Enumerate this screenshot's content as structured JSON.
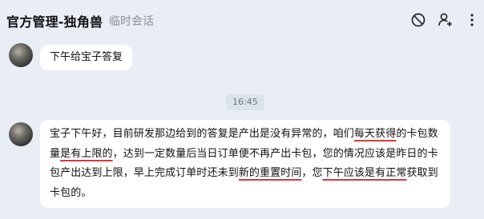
{
  "header": {
    "title": "官方管理-独角兽",
    "subtitle": "临时会话",
    "icons": [
      "block-icon",
      "add-user-icon",
      "more-icon"
    ]
  },
  "messages": [
    {
      "text": "下午给宝子答复"
    },
    {
      "segments": [
        {
          "t": "宝子下午好，目前研发那边给到的答复是产出是没有异常的，咱们"
        },
        {
          "t": "每天获得",
          "ul": true
        },
        {
          "t": "的卡包数量"
        },
        {
          "t": "是有上限的",
          "ul": true
        },
        {
          "t": "，达到一定数量后当日订单便不再产出卡包，您的情况应该是昨日的卡包产出达到上限，早上完成订单时还未到"
        },
        {
          "t": "新的重置时间",
          "ul": true
        },
        {
          "t": "，您"
        },
        {
          "t": "下午应该是有正常",
          "ul": true
        },
        {
          "t": "获取到卡包的。"
        }
      ]
    }
  ],
  "timestamp": "16:45",
  "colors": {
    "background": "#e9eef6",
    "bubble": "#ffffff",
    "underline": "#e0343b"
  }
}
